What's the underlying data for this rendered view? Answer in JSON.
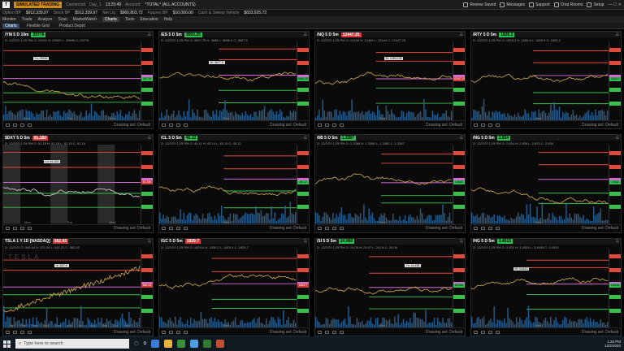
{
  "appbar": {
    "badge": "SIMULATED TRADING",
    "connected": "Connected",
    "session": "Day_1",
    "time": "13:25:49",
    "account_label": "Account:",
    "account_value": "*TOTAL* (ALL ACCOUNTS)",
    "btn_review": "Review Saved",
    "btn_messages": "Messages",
    "btn_support": "Support",
    "btn_chat": "Chat Rooms",
    "btn_setup": "Setup"
  },
  "acctbar": {
    "items": [
      {
        "label": "Option BP",
        "value": "$912,339.97"
      },
      {
        "label": "Stock BP",
        "value": "$912,339.97"
      },
      {
        "label": "Net Liq",
        "value": "$960,803.72"
      },
      {
        "label": "Futures BP",
        "value": "$10,000.00"
      },
      {
        "label": "Cash & Sweep Vehicle",
        "value": "$833,925.72"
      }
    ]
  },
  "nav": [
    "Monitor",
    "Trade",
    "Analyze",
    "Scan",
    "MarketWatch",
    "Charts",
    "Tools",
    "Education",
    "Help"
  ],
  "subtabs": [
    "Charts",
    "Flexible Grid",
    "Product Depot"
  ],
  "charts": [
    {
      "symbol": "/YM 5 D 10m",
      "price": "29776",
      "dir": "up",
      "ohlc": "D: 12/2/20 1:20 PM  O: 29901  H: 29920  L: 29896  C: 29776",
      "x_labels": [
        "Mon",
        "Tue",
        "Wed"
      ],
      "hilo": "Lo: 29426",
      "footer": "Drawing set: Default",
      "accent": "#2fbf4f"
    },
    {
      "symbol": "/ES 5 D 5m",
      "price": "3650.25",
      "dir": "up",
      "ohlc": "D: 12/2/20 1:25 PM  O: 3657.75  H: 3658  L: 3656.5  C: 3657.5",
      "x_labels": [
        "Wed"
      ],
      "hilo": "Hi: 3677.5",
      "footer": "Drawing set: Default",
      "accent": "#2fbf4f"
    },
    {
      "symbol": "/NQ 5 D 5m",
      "price": "12447.25",
      "dir": "down",
      "ohlc": "D: 12/2/20 1:25 PM  O: 12446  H: 12449  L: 12444  C: 12447.25",
      "x_labels": [
        "Wed"
      ],
      "hilo": "Hi: 12512.25",
      "footer": "Drawing set: Default",
      "accent": "#d23b3b"
    },
    {
      "symbol": "/RTY 5 D 5m",
      "price": "1826.2",
      "dir": "up",
      "ohlc": "D: 12/2/20 1:25 PM  O: 1826.2  H: 1826.8  L: 1825.9  C: 1826.2",
      "x_labels": [
        "Wed"
      ],
      "hilo": "",
      "footer": "Drawing set: Default",
      "accent": "#2fbf4f"
    },
    {
      "symbol": "$DXY 5 D 5m",
      "price": "91.160",
      "dir": "down",
      "ohlc": "D: 12/2/20 1:25 PM  O: 91.16  H: 91.16  L: 91.15  C: 91.16",
      "x_labels": [
        "Mon",
        "Tue",
        "Wed"
      ],
      "hilo": "Lo: 91.104",
      "footer": "Drawing set: Default",
      "accent": "#d23b3b"
    },
    {
      "symbol": "/CL 5 D 5m",
      "price": "45.12",
      "dir": "up",
      "ohlc": "D: 12/2/20 1:25 PM  O: 45.11  H: 45.14  L: 45.10  C: 45.12",
      "x_labels": [
        "Wed"
      ],
      "hilo": "",
      "footer": "Drawing set: Default",
      "accent": "#2fbf4f"
    },
    {
      "symbol": "/6B 5 D 5m",
      "price": "1.3387",
      "dir": "up",
      "ohlc": "D: 12/2/20 1:25 PM  O: 1.3386  H: 1.3388  L: 1.3385  C: 1.3387",
      "x_labels": [
        "Wed"
      ],
      "hilo": "",
      "footer": "Drawing set: Default",
      "accent": "#2fbf4f"
    },
    {
      "symbol": "/NG 5 D 5m",
      "price": "2.834",
      "dir": "up",
      "ohlc": "D: 12/2/20 1:25 PM  O: 2.834  H: 2.836  L: 2.833  C: 2.834",
      "x_labels": [
        "Wed"
      ],
      "hilo": "",
      "footer": "Drawing set: Default",
      "accent": "#2fbf4f"
    },
    {
      "symbol": "TSLA 1 Y 1D [NASDAQ]",
      "price": "562.43",
      "dir": "down",
      "ohlc": "D: 12/2/20  O: 556.44  H: 571.54  L: 541.21  C: 562.43",
      "x_labels": [
        "Jan",
        "Feb",
        "Mar",
        "Apr",
        "May",
        "Jun",
        "Jul",
        "Aug",
        "Sep",
        "Oct",
        "Nov"
      ],
      "hilo": "Hi: 607.8",
      "footer": "Drawing set: Default",
      "accent": "#d23b3b"
    },
    {
      "symbol": "/GC 5 D 5m",
      "price": "1829.7",
      "dir": "down",
      "ohlc": "D: 12/2/20 1:25 PM  O: 1829.6  H: 1830.2  L: 1829.4  C: 1829.7",
      "x_labels": [
        "Wed"
      ],
      "hilo": "",
      "footer": "Drawing set: Default",
      "accent": "#d23b3b"
    },
    {
      "symbol": "/SI 5 D 5m",
      "price": "24.060",
      "dir": "up",
      "ohlc": "D: 12/2/20 1:25 PM  O: 24.05  H: 24.07  L: 24.04  C: 24.06",
      "x_labels": [
        "Wed"
      ],
      "hilo": "Hi: 24.455",
      "footer": "Drawing set: Default",
      "accent": "#2fbf4f"
    },
    {
      "symbol": "/HG 5 D 5m",
      "price": "3.4515",
      "dir": "up",
      "ohlc": "D: 12/2/20 1:25 PM  O: 3.451  H: 3.4525  L: 3.4505  C: 3.4515",
      "x_labels": [
        "Wed"
      ],
      "hilo": "Hi: 3.5210",
      "footer": "Drawing set: Default",
      "accent": "#2fbf4f"
    }
  ],
  "tsla_watermark": "TESLA",
  "taskbar": {
    "search_placeholder": "Type here to search",
    "time": "1:25 PM",
    "date": "12/2/2020"
  }
}
